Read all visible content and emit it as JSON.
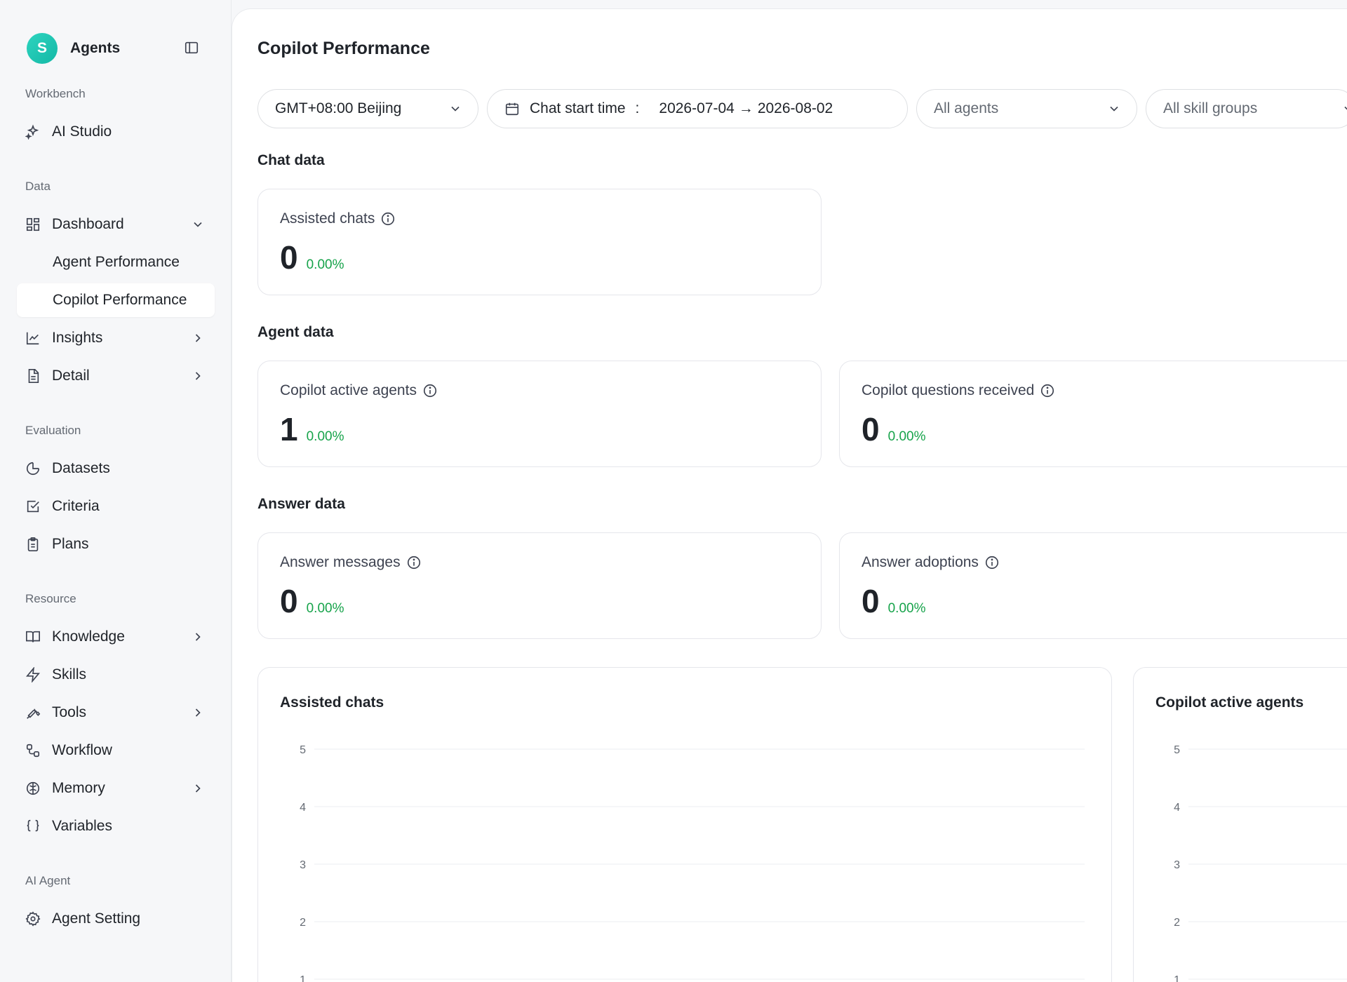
{
  "sidebar": {
    "brand": {
      "avatar_letter": "S",
      "title": "Agents"
    },
    "sections": {
      "workbench": "Workbench",
      "data": "Data",
      "evaluation": "Evaluation",
      "resource": "Resource",
      "ai_agent": "AI Agent"
    },
    "items": {
      "ai_studio": "AI Studio",
      "dashboard": "Dashboard",
      "agent_performance": "Agent Performance",
      "copilot_performance": "Copilot Performance",
      "insights": "Insights",
      "detail": "Detail",
      "datasets": "Datasets",
      "criteria": "Criteria",
      "plans": "Plans",
      "knowledge": "Knowledge",
      "skills": "Skills",
      "tools": "Tools",
      "workflow": "Workflow",
      "memory": "Memory",
      "variables": "Variables",
      "agent_setting": "Agent Setting"
    },
    "active_item": "Copilot Performance"
  },
  "main": {
    "title": "Copilot Performance",
    "filters": {
      "timezone": "GMT+08:00 Beijing",
      "date_label": "Chat start time",
      "date_colon": ":",
      "date_start": "2026-07-04",
      "date_arrow": "→",
      "date_end": "2026-08-02",
      "agents_placeholder": "All agents",
      "skill_groups_placeholder": "All skill groups"
    },
    "chat_data": {
      "title": "Chat data",
      "assisted_chats": {
        "label": "Assisted chats",
        "value": "0",
        "delta": "0.00%"
      }
    },
    "agent_data": {
      "title": "Agent data",
      "active_agents": {
        "label": "Copilot active agents",
        "value": "1",
        "delta": "0.00%"
      },
      "questions_received": {
        "label": "Copilot questions received",
        "value": "0",
        "delta": "0.00%"
      }
    },
    "answer_data": {
      "title": "Answer data",
      "answer_messages": {
        "label": "Answer messages",
        "value": "0",
        "delta": "0.00%"
      },
      "answer_adoptions": {
        "label": "Answer adoptions",
        "value": "0",
        "delta": "0.00%"
      }
    },
    "charts": {
      "assisted_chats_title": "Assisted chats",
      "active_agents_title": "Copilot active agents"
    }
  },
  "colors": {
    "accent": "#14b8a6",
    "positive": "#16a34a",
    "text": "#1f2329",
    "muted": "#646a73"
  },
  "chart_data": [
    {
      "type": "line",
      "title": "Assisted chats",
      "y_ticks": [
        "1",
        "2",
        "3",
        "4",
        "5"
      ],
      "ylim": [
        0,
        5
      ],
      "grid": true,
      "series": []
    },
    {
      "type": "line",
      "title": "Copilot active agents",
      "y_ticks": [
        "1",
        "2",
        "3",
        "4",
        "5"
      ],
      "ylim": [
        0,
        5
      ],
      "grid": true,
      "series": []
    }
  ]
}
